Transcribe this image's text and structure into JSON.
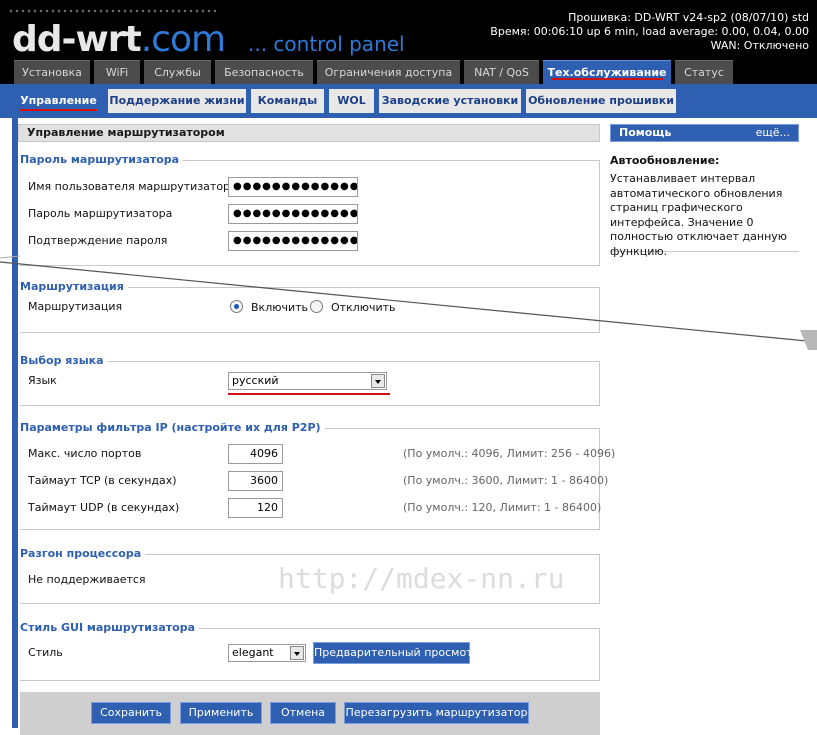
{
  "header": {
    "logo_text": "dd-wrt",
    "logo_domain": ".com",
    "panel_text": "... control panel",
    "firmware": "Прошивка: DD-WRT v24-sp2 (08/07/10) std",
    "uptime": "Время: 00:06:10 up 6 min, load average: 0.00, 0.04, 0.00",
    "wan": "WAN: Отключено"
  },
  "main_tabs": [
    {
      "label": "Установка"
    },
    {
      "label": "WiFi"
    },
    {
      "label": "Службы"
    },
    {
      "label": "Безопасность"
    },
    {
      "label": "Ограничения доступа"
    },
    {
      "label": "NAT / QoS"
    },
    {
      "label": "Тех.обслуживание",
      "active": true
    },
    {
      "label": "Статус"
    }
  ],
  "sub_tabs": [
    {
      "label": "Управление",
      "active": true
    },
    {
      "label": "Поддержание жизни"
    },
    {
      "label": "Команды"
    },
    {
      "label": "WOL"
    },
    {
      "label": "Заводские установки"
    },
    {
      "label": "Обновление прошивки"
    }
  ],
  "main": {
    "title": "Управление маршрутизатором",
    "password": {
      "legend": "Пароль маршрутизатора",
      "username_label": "Имя пользователя маршрутизатора",
      "username_value": "●●●●●●●●●●●●●●●●",
      "password_label": "Пароль маршрутизатора",
      "password_value": "●●●●●●●●●●●●●●●●",
      "confirm_label": "Подтверждение пароля",
      "confirm_value": "●●●●●●●●●●●●●●●●"
    },
    "routing": {
      "legend": "Маршрутизация",
      "label": "Маршрутизация",
      "enable": "Включить",
      "disable": "Отключить"
    },
    "language": {
      "legend": "Выбор языка",
      "label": "Язык",
      "value": "русский"
    },
    "ip_filter": {
      "legend": "Параметры фильтра IP (настройте их для P2P)",
      "max_ports_label": "Макс. число портов",
      "max_ports_value": "4096",
      "max_ports_hint": "(По умолч.: 4096, Лимит: 256 - 4096)",
      "tcp_label": "Таймаут TCP (в секундах)",
      "tcp_value": "3600",
      "tcp_hint": "(По умолч.: 3600, Лимит: 1 - 86400)",
      "udp_label": "Таймаут UDP (в секундах)",
      "udp_value": "120",
      "udp_hint": "(По умолч.: 120, Лимит: 1 - 86400)"
    },
    "overclock": {
      "legend": "Разгон процессора",
      "text": "Не поддерживается"
    },
    "style": {
      "legend": "Стиль GUI маршрутизатора",
      "label": "Стиль",
      "value": "elegant",
      "preview": "Предварительный просмотр"
    },
    "watermark": "http://mdex-nn.ru",
    "buttons": {
      "save": "Сохранить",
      "apply": "Применить",
      "cancel": "Отмена",
      "reboot": "Перезагрузить маршрутизатор"
    }
  },
  "help": {
    "title": "Помощь",
    "more": "ещё...",
    "heading": "Автообновление:",
    "text": "Устанавливает интервал автоматического обновления страниц графического интерфейса. Значение 0 полностью отключает данную функцию."
  }
}
